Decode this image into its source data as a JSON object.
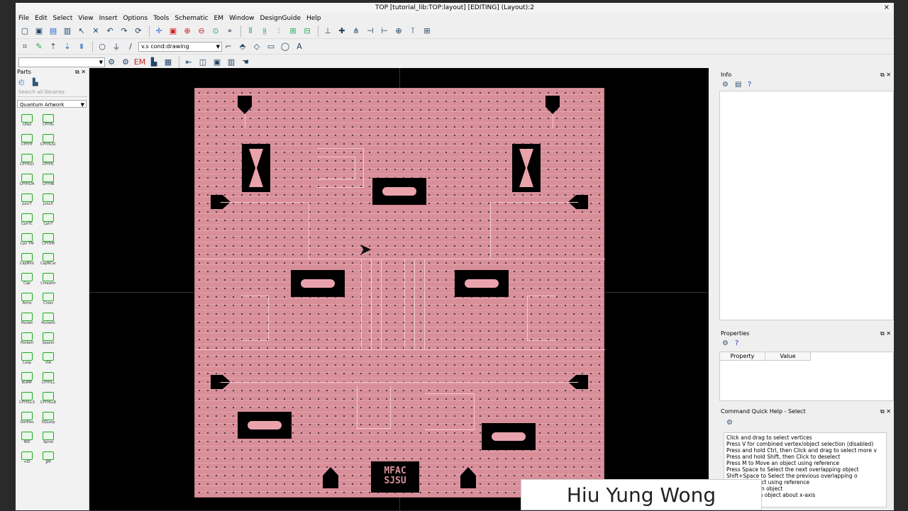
{
  "window": {
    "title": "TOP [tutorial_lib:TOP:layout] [EDITING] (Layout):2",
    "close": "×"
  },
  "menu": [
    "File",
    "Edit",
    "Select",
    "View",
    "Insert",
    "Options",
    "Tools",
    "Schematic",
    "EM",
    "Window",
    "DesignGuide",
    "Help"
  ],
  "toolbar": {
    "layer_combo": "v.s cond:drawing"
  },
  "parts": {
    "title": "Parts",
    "search_placeholder": "Search all libraries",
    "library": "Quantum Artwork",
    "components": [
      "LPad",
      "CPYHL",
      "CPYHT",
      "CPYHLSC",
      "CPYHLO",
      "CPYHC",
      "CPYHCM",
      "CPYHB",
      "JuncT",
      "JuncX",
      "CplrTC",
      "CplrT",
      "Cplr TM",
      "CPYHM",
      "CapNInt",
      "CapNCar",
      "Cap",
      "Cmeamr",
      "Arms",
      "Cross",
      "Pocket",
      "PocketS",
      "PocketI",
      "Spacer",
      "Loop",
      "VIA",
      "BUMP",
      "CPYHLL",
      "CPYHLLS",
      "CPYHLLB",
      "Dotfiles",
      "SQLoop",
      "IND",
      "Spiral",
      "+ID",
      "JJM"
    ]
  },
  "layout": {
    "logo_line1": "MFAC",
    "logo_line2": "SJSU"
  },
  "info": {
    "title": "Info"
  },
  "properties": {
    "title": "Properties",
    "col_property": "Property",
    "col_value": "Value"
  },
  "help": {
    "title": "Command Quick Help - Select",
    "lines": [
      "Click and drag to select vertices",
      "Press V for combined vertex/object selection (disabled)",
      "Press and hold Ctrl, then Click and drag to select more v",
      "Press and hold Shift, then Click to deselect",
      "",
      "Press M to Move an object using reference",
      "Press Space to Select the next overlapping object",
      "Shift+Space to Select the previous overlapping o",
      "Copy an object using reference",
      "R to Rotate an object",
      "X to Mirror an object about x-axis"
    ]
  },
  "watermark": "Hiu Yung Wong"
}
